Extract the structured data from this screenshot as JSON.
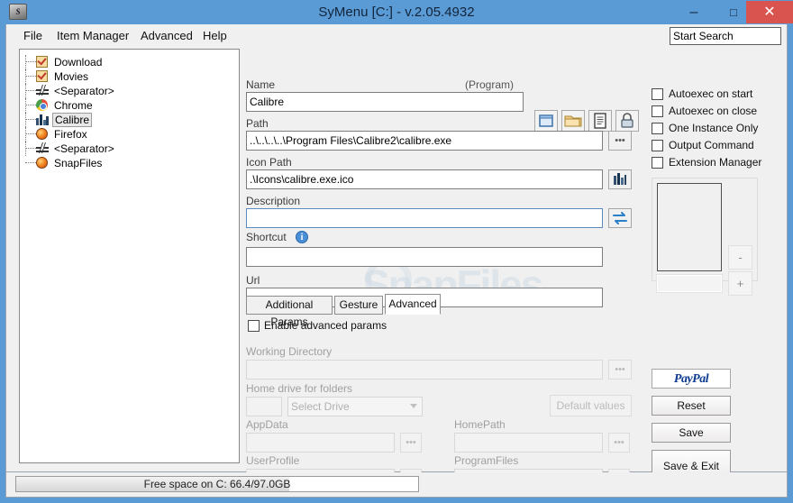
{
  "window": {
    "title": "SyMenu [C:] - v.2.05.4932",
    "app_icon": "symenu-icon",
    "minimize": "–",
    "maximize": "□",
    "close": "✕"
  },
  "menubar": {
    "items": [
      {
        "label": "File"
      },
      {
        "label": "Item Manager"
      },
      {
        "label": "Advanced"
      },
      {
        "label": "Help"
      }
    ]
  },
  "search": {
    "value": "Start Search",
    "placeholder": "Start Search"
  },
  "tree": {
    "items": [
      {
        "label": "Download",
        "icon": "checked-folder-icon",
        "selected": false
      },
      {
        "label": "Movies",
        "icon": "checked-folder-icon",
        "selected": false
      },
      {
        "label": "<Separator>",
        "icon": "separator-icon",
        "selected": false
      },
      {
        "label": "Chrome",
        "icon": "chrome-icon",
        "selected": false
      },
      {
        "label": "Calibre",
        "icon": "calibre-icon",
        "selected": true
      },
      {
        "label": "Firefox",
        "icon": "firefox-icon",
        "selected": false
      },
      {
        "label": "<Separator>",
        "icon": "separator-icon",
        "selected": false
      },
      {
        "label": "SnapFiles",
        "icon": "firefox-icon",
        "selected": false
      }
    ]
  },
  "form": {
    "name_label": "Name",
    "program_tag": "(Program)",
    "name_value": "Calibre",
    "path_label": "Path",
    "path_value": "..\\..\\..\\..\\Program Files\\Calibre2\\calibre.exe",
    "icon_path_label": "Icon Path",
    "icon_path_value": ".\\Icons\\calibre.exe.ico",
    "description_label": "Description",
    "description_value": "",
    "shortcut_label": "Shortcut",
    "shortcut_info_icon": "info-icon",
    "shortcut_value": "",
    "url_label": "Url",
    "url_value": "",
    "browse_ellipsis": "•••",
    "icon_buttons": [
      {
        "name": "window-icon"
      },
      {
        "name": "folder-icon"
      },
      {
        "name": "document-icon"
      },
      {
        "name": "lock-icon"
      }
    ],
    "icon_path_button": "calibre-books-icon",
    "description_button": "refresh-swap-icon"
  },
  "tabs": [
    {
      "label": "Additional Params",
      "active": false
    },
    {
      "label": "Gesture",
      "active": false
    },
    {
      "label": "Advanced",
      "active": true
    }
  ],
  "advanced": {
    "enable_advanced_params_label": "Enable advanced params",
    "enable_advanced_params_checked": false,
    "working_directory_label": "Working Directory",
    "working_directory_value": "",
    "home_drive_label": "Home drive for folders",
    "drive_letter_value": "",
    "select_drive_value": "Select Drive",
    "default_values_button": "Default values",
    "fields": [
      {
        "label": "AppData",
        "value": ""
      },
      {
        "label": "HomePath",
        "value": ""
      },
      {
        "label": "UserProfile",
        "value": ""
      },
      {
        "label": "ProgramFiles",
        "value": ""
      }
    ]
  },
  "options": {
    "checkboxes": [
      {
        "label": "Autoexec on start",
        "checked": false
      },
      {
        "label": "Autoexec on close",
        "checked": false
      },
      {
        "label": "One Instance Only",
        "checked": false
      },
      {
        "label": "Output Command",
        "checked": false
      },
      {
        "label": "Extension Manager",
        "checked": false
      }
    ]
  },
  "preview": {
    "field_value": "",
    "minus_button": "-",
    "plus_button": "+"
  },
  "buttons": {
    "paypal": "PayPal",
    "reset": "Reset",
    "save": "Save",
    "save_exit": "Save & Exit"
  },
  "statusbar": {
    "free_space_text": "Free space on C: 66.4/97.0GB",
    "progress_percent": 68
  },
  "watermark": {
    "text": "SnapFiles"
  },
  "colors": {
    "titlebar": "#5b9bd5",
    "close_button": "#d9534f",
    "client_bg": "#f0f0f0",
    "accent_blue": "#5a8cc0"
  }
}
